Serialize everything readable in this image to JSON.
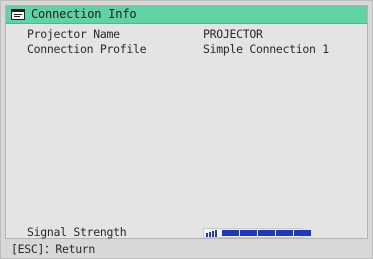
{
  "window": {
    "title": "Connection Info",
    "title_icon": "window-icon"
  },
  "info": {
    "projector_name_label": "Projector Name",
    "projector_name_value": "PROJECTOR",
    "connection_profile_label": "Connection Profile",
    "connection_profile_value": "Simple Connection 1",
    "signal_strength_label": "Signal Strength"
  },
  "signal": {
    "level": 5,
    "max": 5,
    "icon": "signal-icon",
    "bar_color": "#1b38c6"
  },
  "footer": {
    "hint": "[ESC]：Return"
  },
  "colors": {
    "title_bar": "#5fd3a6",
    "panel": "#e4e4e4"
  }
}
